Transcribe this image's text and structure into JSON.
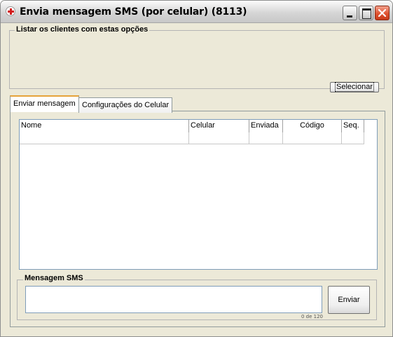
{
  "window": {
    "title": "Envia mensagem SMS (por celular) (8113)",
    "buttons": [
      "minimize",
      "maximize",
      "close"
    ]
  },
  "filter_group": {
    "legend": "Listar os clientes com estas opções",
    "select_button": "Selecionar"
  },
  "tabs": [
    {
      "label": "Enviar mensagem",
      "active": true
    },
    {
      "label": "Configurações do Celular",
      "active": false
    }
  ],
  "grid": {
    "columns": [
      "Nome",
      "Celular",
      "Enviada",
      "Código",
      "Seq."
    ],
    "rows": [
      [
        "",
        "",
        "",
        "",
        ""
      ]
    ]
  },
  "sms_group": {
    "legend": "Mensagem SMS",
    "message_value": "",
    "counter": "0 de 120",
    "send_button": "Enviar"
  },
  "colors": {
    "window_bg": "#ece9d8",
    "tab_highlight": "#e6a33a",
    "close_button": "#e0522f",
    "grid_border": "#7f9db9"
  }
}
